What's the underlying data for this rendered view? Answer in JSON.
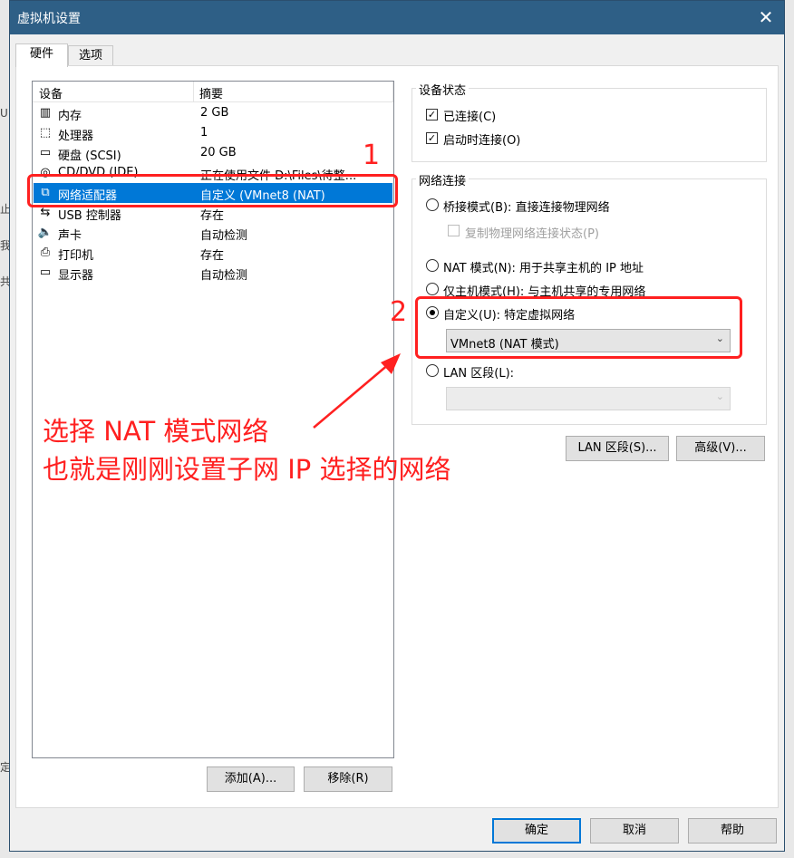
{
  "window": {
    "title": "虚拟机设置",
    "close_glyph": "✕"
  },
  "background_glyphs": [
    "U",
    "止",
    "我",
    "共",
    "定"
  ],
  "tabs": [
    {
      "label": "硬件"
    },
    {
      "label": "选项"
    }
  ],
  "device_list": {
    "headers": {
      "device": "设备",
      "summary": "摘要"
    },
    "rows": [
      {
        "icon": "memory-icon",
        "glyph": "▥",
        "name": "内存",
        "summary": "2 GB"
      },
      {
        "icon": "processor-icon",
        "glyph": "⬚",
        "name": "处理器",
        "summary": "1"
      },
      {
        "icon": "harddisk-icon",
        "glyph": "▭",
        "name": "硬盘 (SCSI)",
        "summary": "20 GB"
      },
      {
        "icon": "cdrom-icon",
        "glyph": "◎",
        "name": "CD/DVD (IDE)",
        "summary": "正在使用文件 D:\\Files\\待整..."
      },
      {
        "icon": "network-adapter-icon",
        "glyph": "⧉",
        "name": "网络适配器",
        "summary": "自定义 (VMnet8 (NAT)",
        "selected": true
      },
      {
        "icon": "usb-icon",
        "glyph": "⇆",
        "name": "USB 控制器",
        "summary": "存在"
      },
      {
        "icon": "sound-icon",
        "glyph": "🔈",
        "name": "声卡",
        "summary": "自动检测"
      },
      {
        "icon": "printer-icon",
        "glyph": "⎙",
        "name": "打印机",
        "summary": "存在"
      },
      {
        "icon": "display-icon",
        "glyph": "▭",
        "name": "显示器",
        "summary": "自动检测"
      }
    ]
  },
  "list_buttons": {
    "add": "添加(A)...",
    "remove": "移除(R)"
  },
  "device_status": {
    "title": "设备状态",
    "connected": {
      "label": "已连接(C)",
      "checked": true
    },
    "connect_on_power": {
      "label": "启动时连接(O)",
      "checked": true
    }
  },
  "network": {
    "title": "网络连接",
    "bridged": {
      "label": "桥接模式(B): 直接连接物理网络",
      "selected": false
    },
    "replicate": {
      "label": "复制物理网络连接状态(P)",
      "checked": false,
      "disabled": true
    },
    "nat": {
      "label": "NAT 模式(N): 用于共享主机的 IP 地址",
      "selected": false
    },
    "hostonly": {
      "label": "仅主机模式(H): 与主机共享的专用网络",
      "selected": false
    },
    "custom": {
      "label": "自定义(U): 特定虚拟网络",
      "selected": true,
      "value": "VMnet8 (NAT 模式)"
    },
    "lan": {
      "label": "LAN 区段(L):",
      "selected": false,
      "value": ""
    }
  },
  "net_buttons": {
    "lan": "LAN 区段(S)...",
    "advanced": "高级(V)..."
  },
  "footer": {
    "ok": "确定",
    "cancel": "取消",
    "help": "帮助"
  },
  "annotations": {
    "num1": "1",
    "num2": "2",
    "line1": "选择 NAT 模式网络",
    "line2": "也就是刚刚设置子网 IP 选择的网络"
  },
  "colors": {
    "annotation": "#ff2020",
    "selection": "#0078d7",
    "titlebar": "#2e5f86"
  }
}
